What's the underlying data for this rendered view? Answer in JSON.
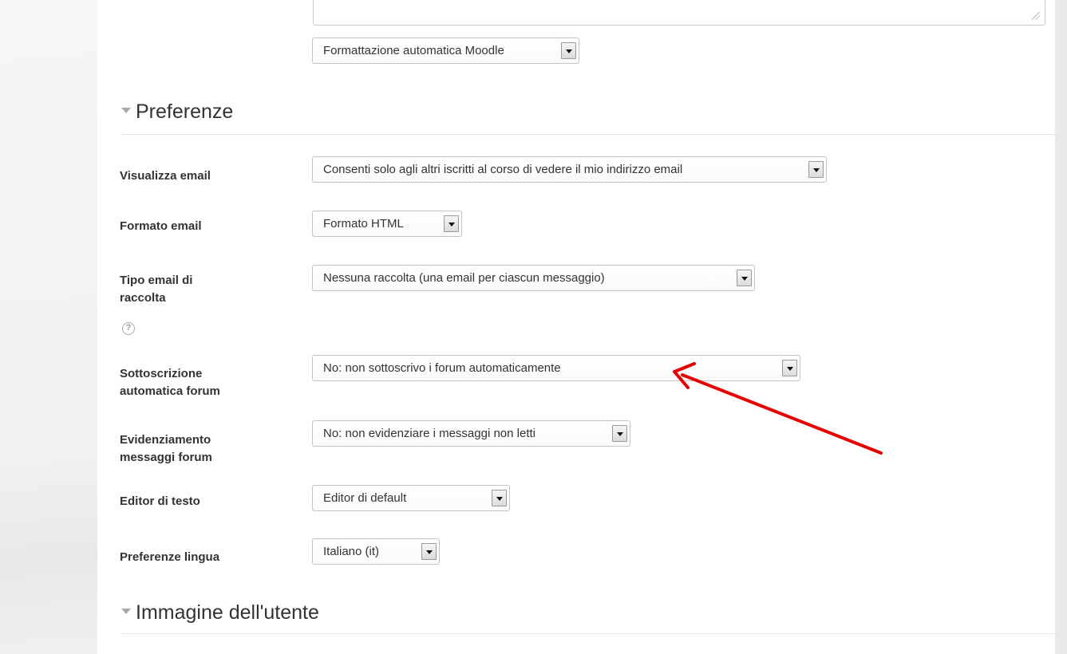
{
  "top_select": {
    "value": "Formattazione automatica Moodle"
  },
  "sections": {
    "preferences_title": "Preferenze",
    "user_image_title": "Immagine dell'utente"
  },
  "fields": {
    "email_display": {
      "label": "Visualizza email",
      "value": "Consenti solo agli altri iscritti al corso di vedere il mio indirizzo email"
    },
    "email_format": {
      "label": "Formato email",
      "value": "Formato HTML"
    },
    "digest_type": {
      "label": "Tipo email di raccolta",
      "value": "Nessuna raccolta (una email per ciascun messaggio)"
    },
    "auto_subscribe": {
      "label": "Sottoscrizione automatica forum",
      "value": "No: non sottoscrivo i forum automaticamente"
    },
    "track_forums": {
      "label": "Evidenziamento messaggi forum",
      "value": "No: non evidenziare i messaggi non letti"
    },
    "text_editor": {
      "label": "Editor di testo",
      "value": "Editor di default"
    },
    "language": {
      "label": "Preferenze lingua",
      "value": "Italiano (it)"
    }
  },
  "icons": {
    "help": "question-circle-icon",
    "section_toggle": "triangle-down-icon",
    "dropdown": "chevron-down-icon"
  },
  "colors": {
    "annotation_arrow": "#e60000",
    "text": "#333333",
    "border": "#c4c4c4"
  }
}
